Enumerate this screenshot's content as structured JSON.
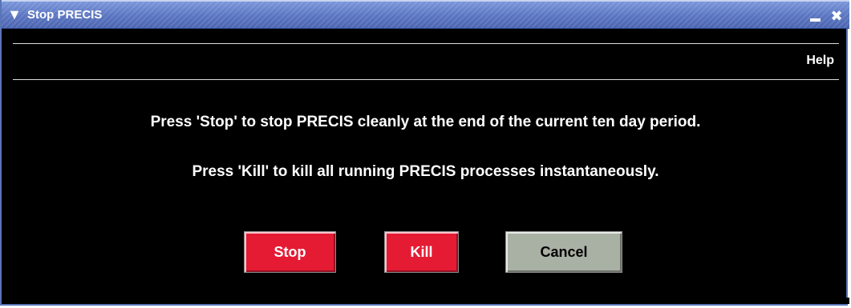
{
  "window": {
    "title": "Stop PRECIS",
    "menu_icon": "chevron-down-icon",
    "minimize_icon": "minimize-icon",
    "close_icon": "close-icon",
    "close_glyph": "✖"
  },
  "menubar": {
    "help_label": "Help"
  },
  "message": {
    "line1": "Press 'Stop' to stop PRECIS cleanly at the end of the current ten day period.",
    "line2": "Press 'Kill' to kill all running PRECIS  processes instantaneously."
  },
  "buttons": {
    "stop_label": "Stop",
    "kill_label": "Kill",
    "cancel_label": "Cancel"
  },
  "colors": {
    "background": "#000000",
    "titlebar": "#5a74c0",
    "danger": "#e51b34",
    "cancel": "#a9b0a4"
  }
}
